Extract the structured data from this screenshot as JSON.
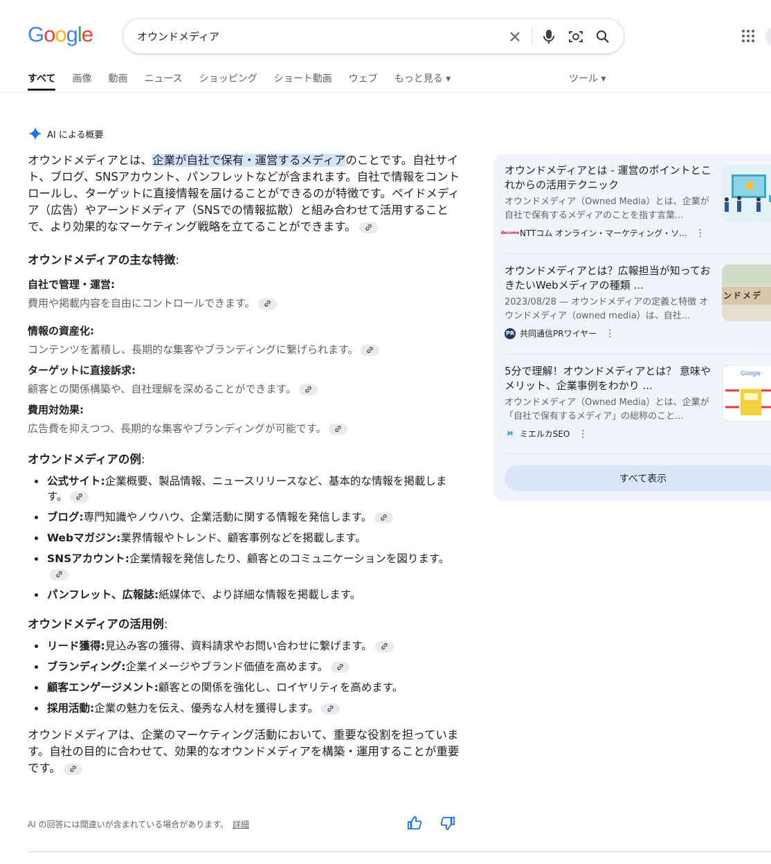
{
  "logo": [
    "G",
    "o",
    "o",
    "g",
    "l",
    "e"
  ],
  "search": {
    "query": "オウンドメディア"
  },
  "tabs": [
    "すべて",
    "画像",
    "動画",
    "ニュース",
    "ショッピング",
    "ショート動画",
    "ウェブ",
    "もっと見る ▾"
  ],
  "tools": "ツール ▾",
  "ai": {
    "header": "AI による概要",
    "intro_pre": "オウンドメディアとは、",
    "intro_hl": "企業が自社で保有・運営するメディア",
    "intro_post": "のことです。自社サイト、ブログ、SNSアカウント、パンフレットなどが含まれます。自社で情報をコントロールし、ターゲットに直接情報を届けることができるのが特徴です。ペイドメディア（広告）やアーンドメディア（SNSでの情報拡散）と組み合わせて活用することで、より効果的なマーケティング戦略を立てることができます。",
    "features_heading": "オウンドメディアの主な特徴",
    "features": [
      {
        "title": "自社で管理・運営:",
        "desc": "費用や掲載内容を自由にコントロールできます。"
      },
      {
        "title": "情報の資産化:",
        "desc": "コンテンツを蓄積し、長期的な集客やブランディングに繋げられます。"
      },
      {
        "title": "ターゲットに直接訴求:",
        "desc": "顧客との関係構築や、自社理解を深めることができます。"
      },
      {
        "title": "費用対効果:",
        "desc": "広告費を抑えつつ、長期的な集客やブランディングが可能です。"
      }
    ],
    "examples_heading": "オウンドメディアの例",
    "examples": [
      {
        "b": "公式サイト:",
        "t": "企業概要、製品情報、ニュースリリースなど、基本的な情報を掲載します。"
      },
      {
        "b": "ブログ:",
        "t": "専門知識やノウハウ、企業活動に関する情報を発信します。"
      },
      {
        "b": "Webマガジン:",
        "t": "業界情報やトレンド、顧客事例などを掲載します。"
      },
      {
        "b": "SNSアカウント:",
        "t": "企業情報を発信したり、顧客とのコミュニケーションを図ります。"
      },
      {
        "b": "パンフレット、広報誌:",
        "t": "紙媒体で、より詳細な情報を掲載します。"
      }
    ],
    "uses_heading": "オウンドメディアの活用例",
    "uses": [
      {
        "b": "リード獲得:",
        "t": "見込み客の獲得、資料請求やお問い合わせに繋げます。"
      },
      {
        "b": "ブランディング:",
        "t": "企業イメージやブランド価値を高めます。"
      },
      {
        "b": "顧客エンゲージメント:",
        "t": "顧客との関係を強化し、ロイヤリティを高めます。"
      },
      {
        "b": "採用活動:",
        "t": "企業の魅力を伝え、優秀な人材を獲得します。"
      }
    ],
    "conclusion": "オウンドメディアは、企業のマーケティング活動において、重要な役割を担っています。自社の目的に合わせて、効果的なオウンドメディアを構築・運用することが重要です。",
    "disclaimer": "AI の回答には間違いが含まれている場合があります。",
    "details_link": "詳細"
  },
  "sources": [
    {
      "title": "オウンドメディアとは - 運営のポイントとこれからの活用テクニック",
      "snippet": "オウンドメディア（Owned Media）とは、企業が自社で保有するメディアのことを指す言葉...",
      "site": "NTTコム オンライン・マーケティング・ソ...",
      "fav": "docomo"
    },
    {
      "title": "オウンドメディアとは？広報担当が知っておきたいWebメディアの種類 ...",
      "snippet": "2023/08/28 — オウンドメディアの定義と特徴 オウンドメディア（owned media）は、自社...",
      "site": "共同通信PRワイヤー",
      "fav": "PR"
    },
    {
      "title": "5分で理解！オウンドメディアとは？ 意味やメリット、企業事例をわかり ...",
      "snippet": "オウンドメディア（Owned Media）とは、企業が「自社で保有するメディア」の総称のこと...",
      "site": "ミエルカSEO",
      "fav": "M"
    }
  ],
  "source_img2_text": "ンドメデ",
  "source_img3_logo": "Google",
  "show_all": "すべて表示",
  "colors": {
    "accent": "#1a73e8",
    "panel_bg": "#f1f5fb",
    "highlight": "#d3e3fd"
  }
}
